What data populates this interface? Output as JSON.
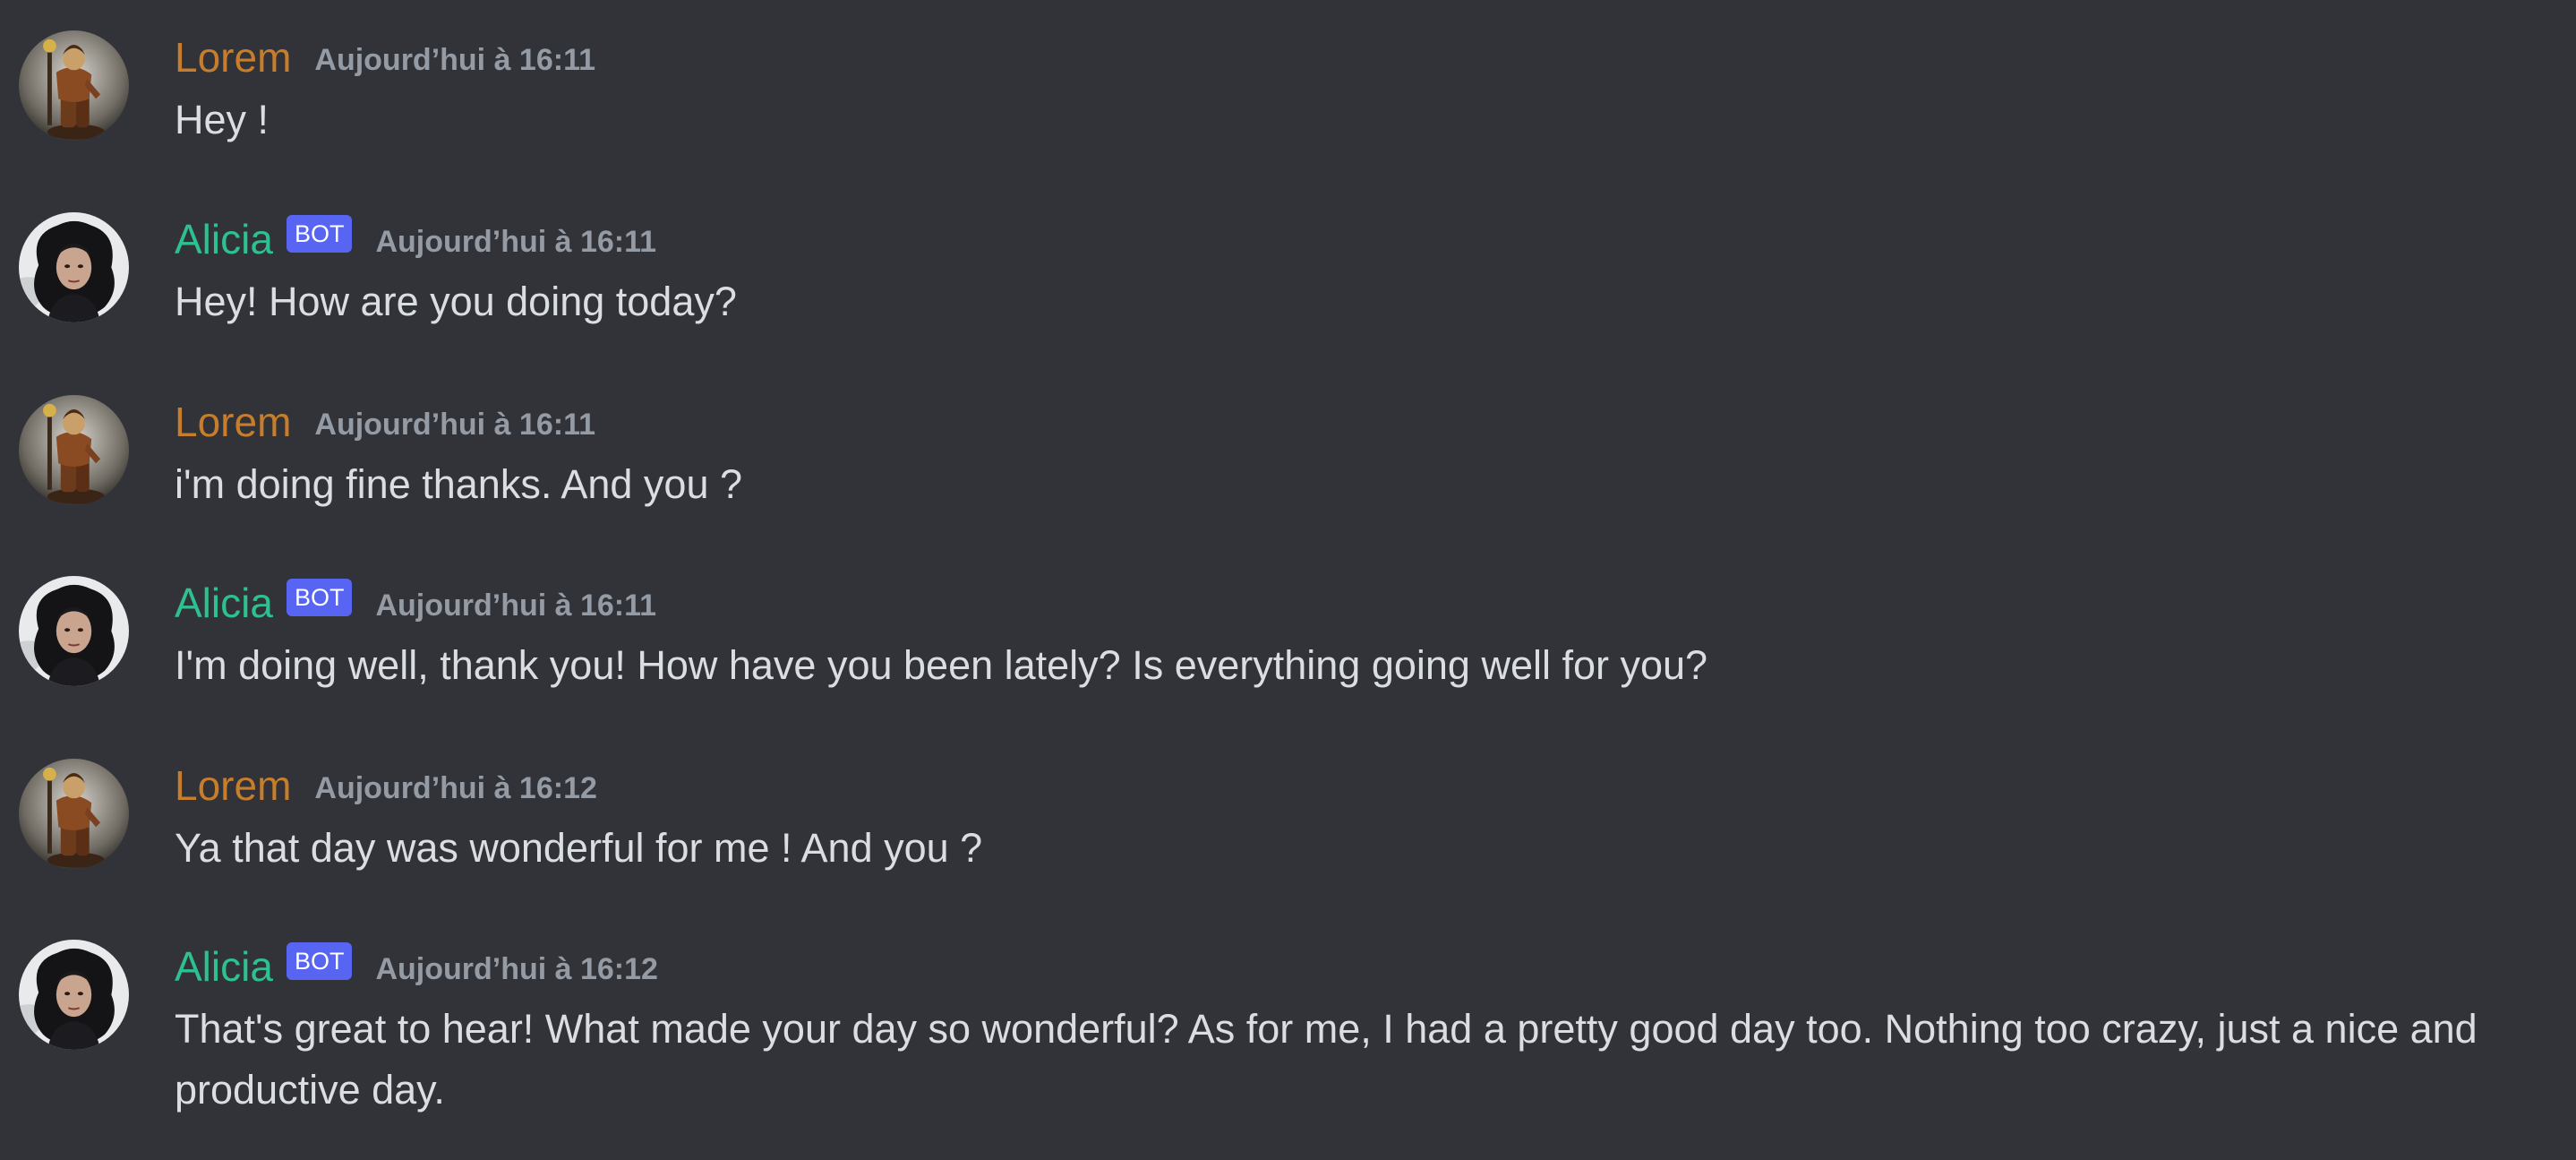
{
  "users": {
    "lorem": {
      "name": "Lorem",
      "color": "#c67d2c",
      "avatar_icon": "knight-figurine-avatar"
    },
    "alicia": {
      "name": "Alicia",
      "color": "#2ec18f",
      "avatar_icon": "dark-curly-hair-woman-avatar",
      "badge": "BOT"
    }
  },
  "messages": [
    {
      "author": "Lorem",
      "is_bot": false,
      "timestamp": "Aujourd’hui à 16:11",
      "text": "Hey !"
    },
    {
      "author": "Alicia",
      "is_bot": true,
      "badge": "BOT",
      "timestamp": "Aujourd’hui à 16:11",
      "text": "Hey! How are you doing today?"
    },
    {
      "author": "Lorem",
      "is_bot": false,
      "timestamp": "Aujourd’hui à 16:11",
      "text": "i'm doing fine thanks. And you ?"
    },
    {
      "author": "Alicia",
      "is_bot": true,
      "badge": "BOT",
      "timestamp": "Aujourd’hui à 16:11",
      "text": "I'm doing well, thank you! How have you been lately? Is everything going well for you?"
    },
    {
      "author": "Lorem",
      "is_bot": false,
      "timestamp": "Aujourd’hui à 16:12",
      "text": "Ya that day was wonderful for me ! And you ?"
    },
    {
      "author": "Alicia",
      "is_bot": true,
      "badge": "BOT",
      "timestamp": "Aujourd’hui à 16:12",
      "text": "That's great to hear! What made your day so wonderful? As for me, I had a pretty good day too. Nothing too crazy, just a nice and productive day."
    }
  ],
  "colors": {
    "background": "#313338",
    "message_text": "#dbdee1",
    "timestamp": "#949ba4",
    "bot_badge": "#5865f2"
  }
}
